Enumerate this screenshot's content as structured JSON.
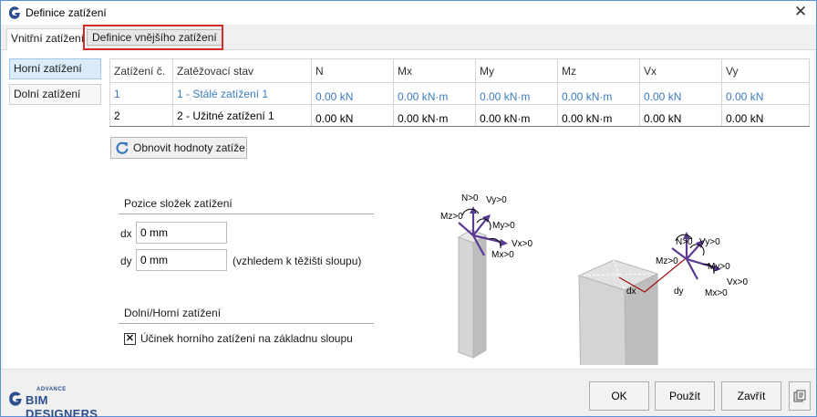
{
  "window": {
    "title": "Definice zatížení",
    "close_glyph": "✕"
  },
  "tabs": [
    {
      "label": "Vnitřní zatížení"
    },
    {
      "label": "Definice vnějšího zatížení"
    }
  ],
  "side": {
    "top_label": "Horní zatížení",
    "bottom_label": "Dolní zatížení"
  },
  "table": {
    "headers": [
      "Zatížení č.",
      "Zatěžovací stav",
      "N",
      "Mx",
      "My",
      "Mz",
      "Vx",
      "Vy"
    ],
    "rows": [
      [
        "1",
        "1 - Stálé zatížení 1",
        "0.00 kN",
        "0.00 kN·m",
        "0.00 kN·m",
        "0.00 kN·m",
        "0.00 kN",
        "0.00 kN"
      ],
      [
        "2",
        "2 - Užitné zatížení 1",
        "0.00 kN",
        "0.00 kN·m",
        "0.00 kN·m",
        "0.00 kN·m",
        "0.00 kN",
        "0.00 kN"
      ]
    ]
  },
  "refresh_button": "Obnovit hodnoty zatíže",
  "position": {
    "title": "Pozice složek zatížení",
    "dx_label": "dx",
    "dx_value": "0 mm",
    "dy_label": "dy",
    "dy_value": "0 mm",
    "note": "(vzhledem k těžišti sloupu)"
  },
  "bottom_top": {
    "title": "Dolní/Horní zatížení",
    "checkbox_label": "Účinek horního zatížení na základnu sloupu",
    "checked": true,
    "check_glyph": "✕"
  },
  "diagram": {
    "left": {
      "n": "N>0",
      "vy": "Vy>0",
      "mz": "Mz>0",
      "my": "My>0",
      "vx": "Vx>0",
      "mx": "Mx>0"
    },
    "right": {
      "n": "N>0",
      "vy": "Vy>0",
      "mz": "Mz>0",
      "my": "My>0",
      "vx": "Vx>0",
      "mx": "Mx>0",
      "dx": "dx",
      "dy": "dy"
    }
  },
  "footer": {
    "logo_advance": "ADVANCE",
    "logo_text": "BIM DESIGNERS",
    "ok": "OK",
    "apply": "Použít",
    "close": "Zavřít"
  },
  "colors": {
    "accent_arrow": "#5b3a92",
    "link_blue": "#3b7bbd",
    "highlight_red": "#d42a2a"
  }
}
